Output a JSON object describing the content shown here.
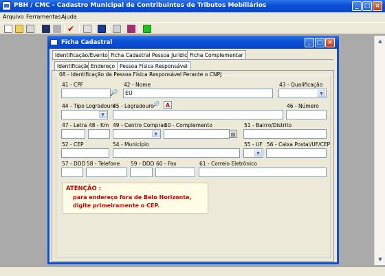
{
  "app": {
    "title": "PBH / CMC - Cadastro Municipal de Contribuintes de Tributos Mobiliários"
  },
  "menu": [
    "Arquivo",
    "Ferramentas",
    "Ajuda"
  ],
  "window_controls": {
    "minimize": "_",
    "maximize": "□",
    "close": "×"
  },
  "child": {
    "title": "Ficha Cadastral"
  },
  "tabs_row1": [
    "Identificação/Eventos",
    "Ficha Cadastral Pessoa Jurídica",
    "Ficha Complementar"
  ],
  "tabs_row2": [
    "Identificação",
    "Endereço",
    "Pessoa Física Responsável"
  ],
  "section": {
    "title": "08 - Identificação da Pessoa Física Responsável Perante o CNPJ"
  },
  "fields": {
    "cpf": {
      "label": "41 - CPF",
      "value": ""
    },
    "nome": {
      "label": "42 - Nome",
      "value": "EU"
    },
    "qualificacao": {
      "label": "43 - Qualificação",
      "value": ""
    },
    "tipo_logradouro": {
      "label": "44 - Tipo Logradouro",
      "value": ""
    },
    "logradouro": {
      "label": "45 - Logradouro",
      "value": ""
    },
    "numero": {
      "label": "46 - Número",
      "value": ""
    },
    "letra": {
      "label": "47 - Letra",
      "value": ""
    },
    "km": {
      "label": "48 - Km",
      "value": ""
    },
    "centro_compras": {
      "label": "49 - Centro Compras",
      "value": ""
    },
    "complemento": {
      "label": "50 - Complemento",
      "value": ""
    },
    "bairro": {
      "label": "51 - Bairro/Distrito",
      "value": ""
    },
    "cep": {
      "label": "52 - CEP",
      "value": ""
    },
    "municipio": {
      "label": "54 - Município",
      "value": ""
    },
    "uf": {
      "label": "55 - UF",
      "value": ""
    },
    "caixa_postal": {
      "label": "56 - Caixa Postal/UF/CEP",
      "value": ""
    },
    "ddd1": {
      "label": "57 - DDD",
      "value": ""
    },
    "telefone": {
      "label": "58 - Telefone",
      "value": ""
    },
    "ddd2": {
      "label": "59 - DDD",
      "value": ""
    },
    "fax": {
      "label": "60 - Fax",
      "value": ""
    },
    "email": {
      "label": "61 - Correio Eletrônico",
      "value": ""
    }
  },
  "alert": {
    "title": "ATENÇÃO :",
    "line1": "para endereço fora de Belo Horizonte,",
    "line2": "digite primeiramente o CEP."
  },
  "icons": {
    "search": "🔎",
    "letter_a": "A",
    "dropdown": "▼",
    "scroll_up": "▲",
    "scroll_down": "▼"
  }
}
